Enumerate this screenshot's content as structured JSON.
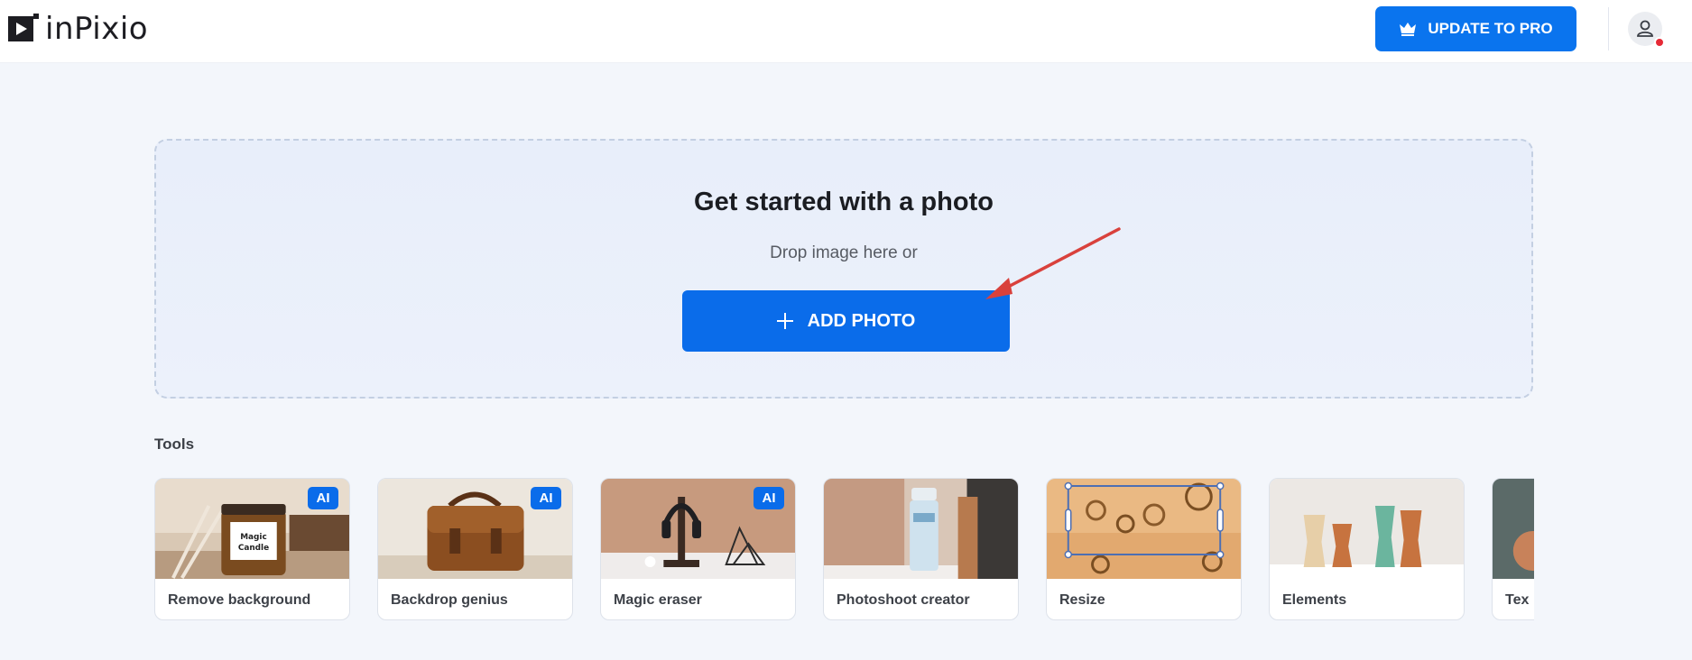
{
  "app": {
    "name": "inPixio"
  },
  "header": {
    "upgrade_label": "UPDATE TO PRO",
    "upgrade_icon": "crown-icon",
    "account_icon": "user-icon",
    "notification_color": "#e62a36"
  },
  "upload": {
    "title": "Get started with a photo",
    "subtitle": "Drop image here or",
    "add_label": "ADD PHOTO",
    "add_icon": "plus-icon"
  },
  "tools": {
    "heading": "Tools",
    "items": [
      {
        "label": "Remove background",
        "badge": "AI",
        "thumb": "candle-jar-photo"
      },
      {
        "label": "Backdrop genius",
        "badge": "AI",
        "thumb": "leather-bag-photo"
      },
      {
        "label": "Magic eraser",
        "badge": "AI",
        "thumb": "headphones-stand-photo"
      },
      {
        "label": "Photoshoot creator",
        "badge": "",
        "thumb": "water-bottle-photo"
      },
      {
        "label": "Resize",
        "badge": "",
        "thumb": "rings-photo"
      },
      {
        "label": "Elements",
        "badge": "",
        "thumb": "vases-photo"
      },
      {
        "label": "Tex",
        "badge": "",
        "thumb": "text-photo"
      }
    ]
  },
  "colors": {
    "accent": "#0a6cea",
    "annotation_arrow": "#d9413c"
  }
}
